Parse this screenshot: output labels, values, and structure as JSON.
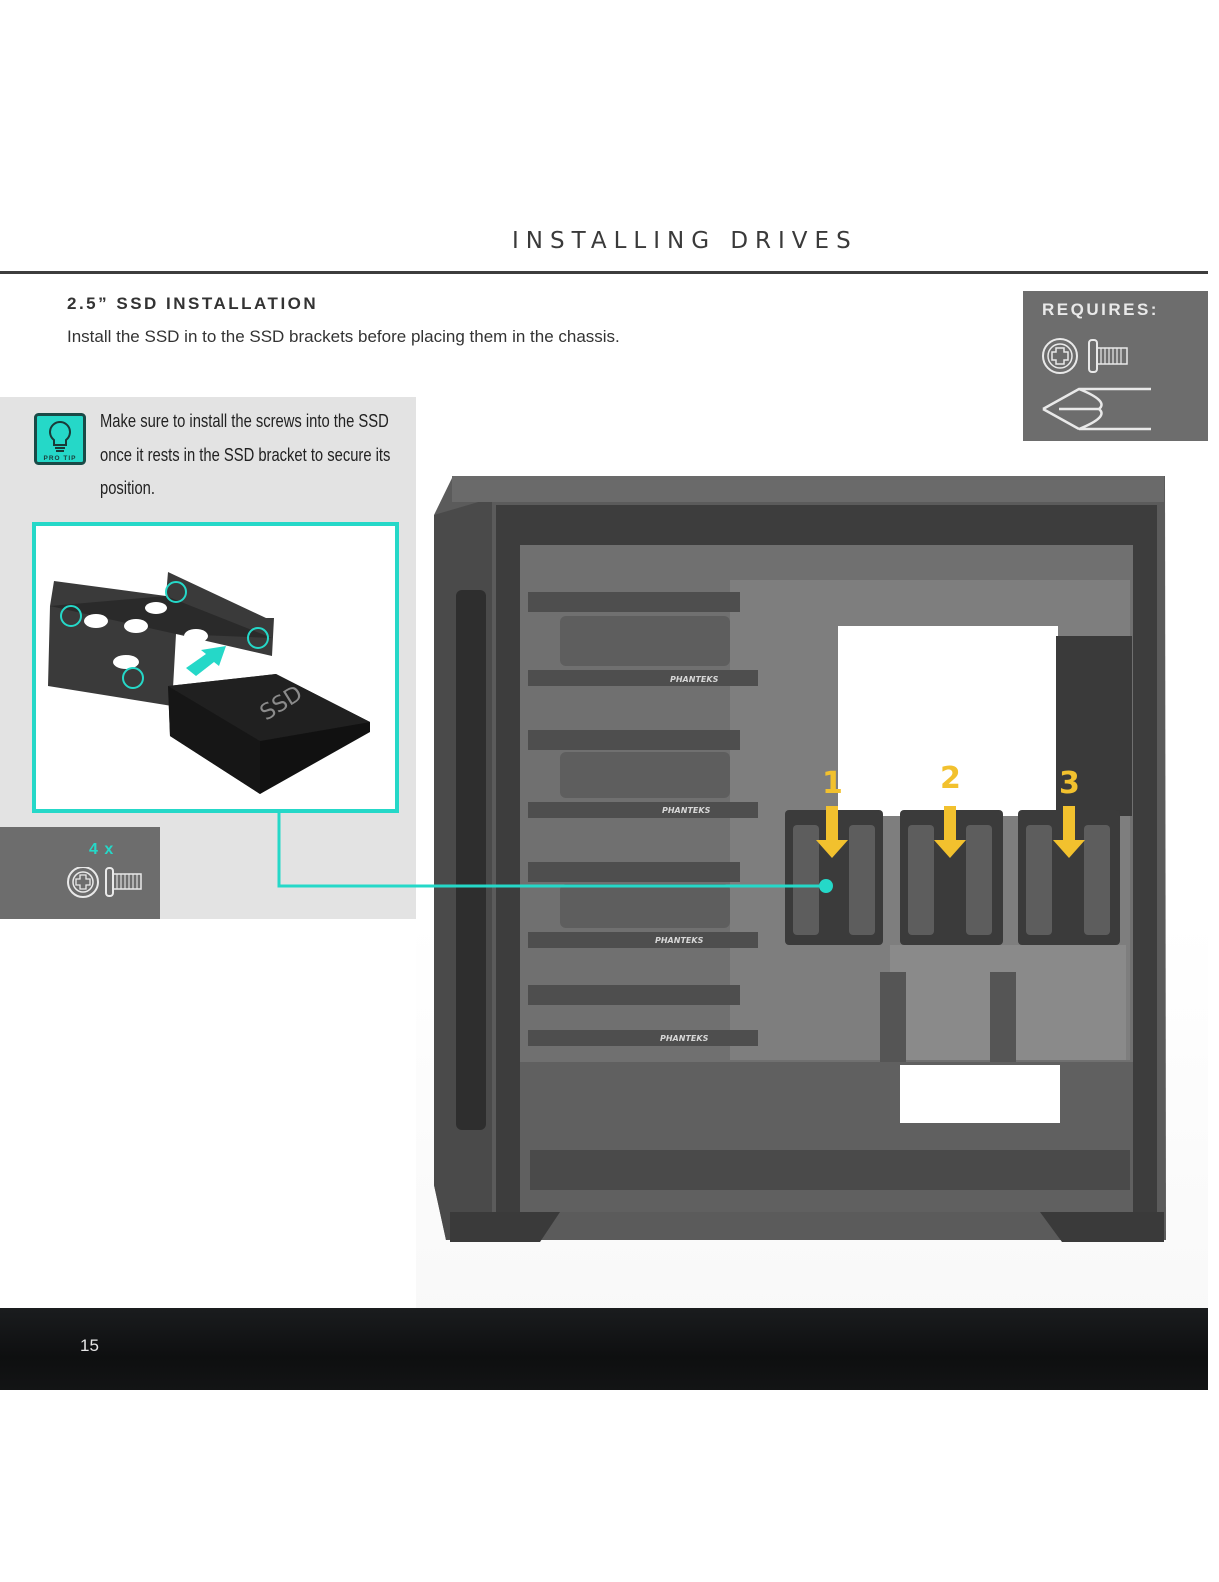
{
  "header": {
    "title": "INSTALLING DRIVES"
  },
  "section": {
    "heading": "2.5” SSD INSTALLATION",
    "intro": "Install the SSD in to the SSD brackets before placing them in the chassis."
  },
  "requires": {
    "label": "REQUIRES:",
    "items": [
      "screw-icon",
      "screwdriver-icon"
    ]
  },
  "pro_tip": {
    "badge": "PRO TIP",
    "lines": [
      "Make sure to install the screws into the SSD",
      "once it rests in the SSD bracket to secure its",
      "position."
    ]
  },
  "illustration": {
    "ssd_label": "SSD"
  },
  "screws": {
    "count_label": "4 x"
  },
  "case": {
    "brand_labels": [
      "PHANTEKS",
      "PHANTEKS",
      "PHANTEKS",
      "PHANTEKS"
    ],
    "bracket_numbers": [
      "1",
      "2",
      "3"
    ]
  },
  "colors": {
    "accent": "#25d8c8",
    "arrow": "#f2c12e",
    "panel": "#6d6d6d"
  },
  "footer": {
    "page_number": "15"
  }
}
